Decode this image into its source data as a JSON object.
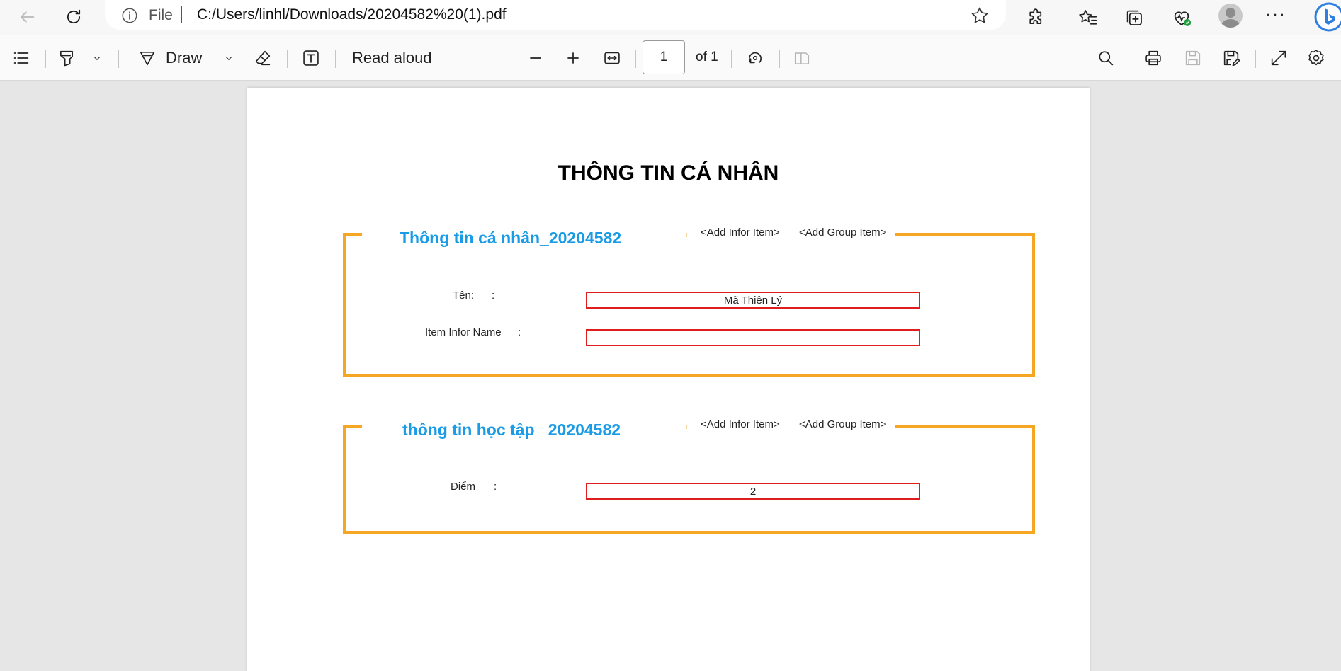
{
  "browser": {
    "address": {
      "scheme_label": "File",
      "url": "C:/Users/linhl/Downloads/20204582%20(1).pdf"
    },
    "icons": [
      "back-icon",
      "refresh-icon",
      "info-icon",
      "favorite-star-icon",
      "extensions-icon",
      "favorites-icon",
      "collections-icon",
      "browser-essentials-icon",
      "profile-avatar",
      "more-icon",
      "copilot-icon"
    ]
  },
  "pdf_toolbar": {
    "draw_label": "Draw",
    "read_aloud_label": "Read aloud",
    "page_number": "1",
    "page_of": "of 1"
  },
  "document": {
    "title": "THÔNG TIN CÁ NHÂN",
    "groups": [
      {
        "title": "Thông tin cá nhân_20204582",
        "add_infor": "<Add Infor Item>",
        "add_group": "<Add Group Item>",
        "fields": [
          {
            "label": "Tên:",
            "colon": ":",
            "value": "Mã Thiên Lý"
          },
          {
            "label": "Item Infor Name",
            "colon": ":",
            "value": ""
          }
        ]
      },
      {
        "title": "thông tin học tập _20204582",
        "add_infor": "<Add Infor Item>",
        "add_group": "<Add Group Item>",
        "fields": [
          {
            "label": "Điểm",
            "colon": ":",
            "value": "2"
          }
        ]
      }
    ]
  },
  "colors": {
    "group_border": "#f5a623",
    "group_title": "#1a9be6",
    "field_border": "#e01e1e"
  }
}
